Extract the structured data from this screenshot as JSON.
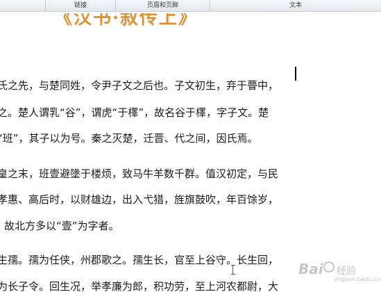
{
  "ribbon": {
    "groups": [
      "链接",
      "页眉和页脚",
      "文本"
    ]
  },
  "document": {
    "title": "《汉书·叙传上》",
    "lines": [
      "氏之先，与楚同姓，令尹子文之后也。子文初生，弃于瞢中，",
      "之。楚人谓乳“谷”，谓虎“于檡”，故名谷于檡，字子文。楚",
      "“班”，其子以为号。秦之灭楚，迁晋、代之间，因氏焉。",
      "皇之末，班壹避墬于楼烦，致马牛羊数千群。值汉初定，与民",
      "孝惠、高后时，以财雄边，出入弋猎，旌旗鼓吹，年百馀岁，",
      "故北方多以“壹”为字者。",
      "生孺。孺为任侠，州郡歌之。孺生长，官至上谷守。长生回，",
      "为长子令。回生况，举孝廉为郎，积功劳，至上河农都尉，大"
    ]
  },
  "watermark": {
    "logo": "Bai",
    "sub": "经验",
    "url": "jingyan.baidu.com"
  }
}
